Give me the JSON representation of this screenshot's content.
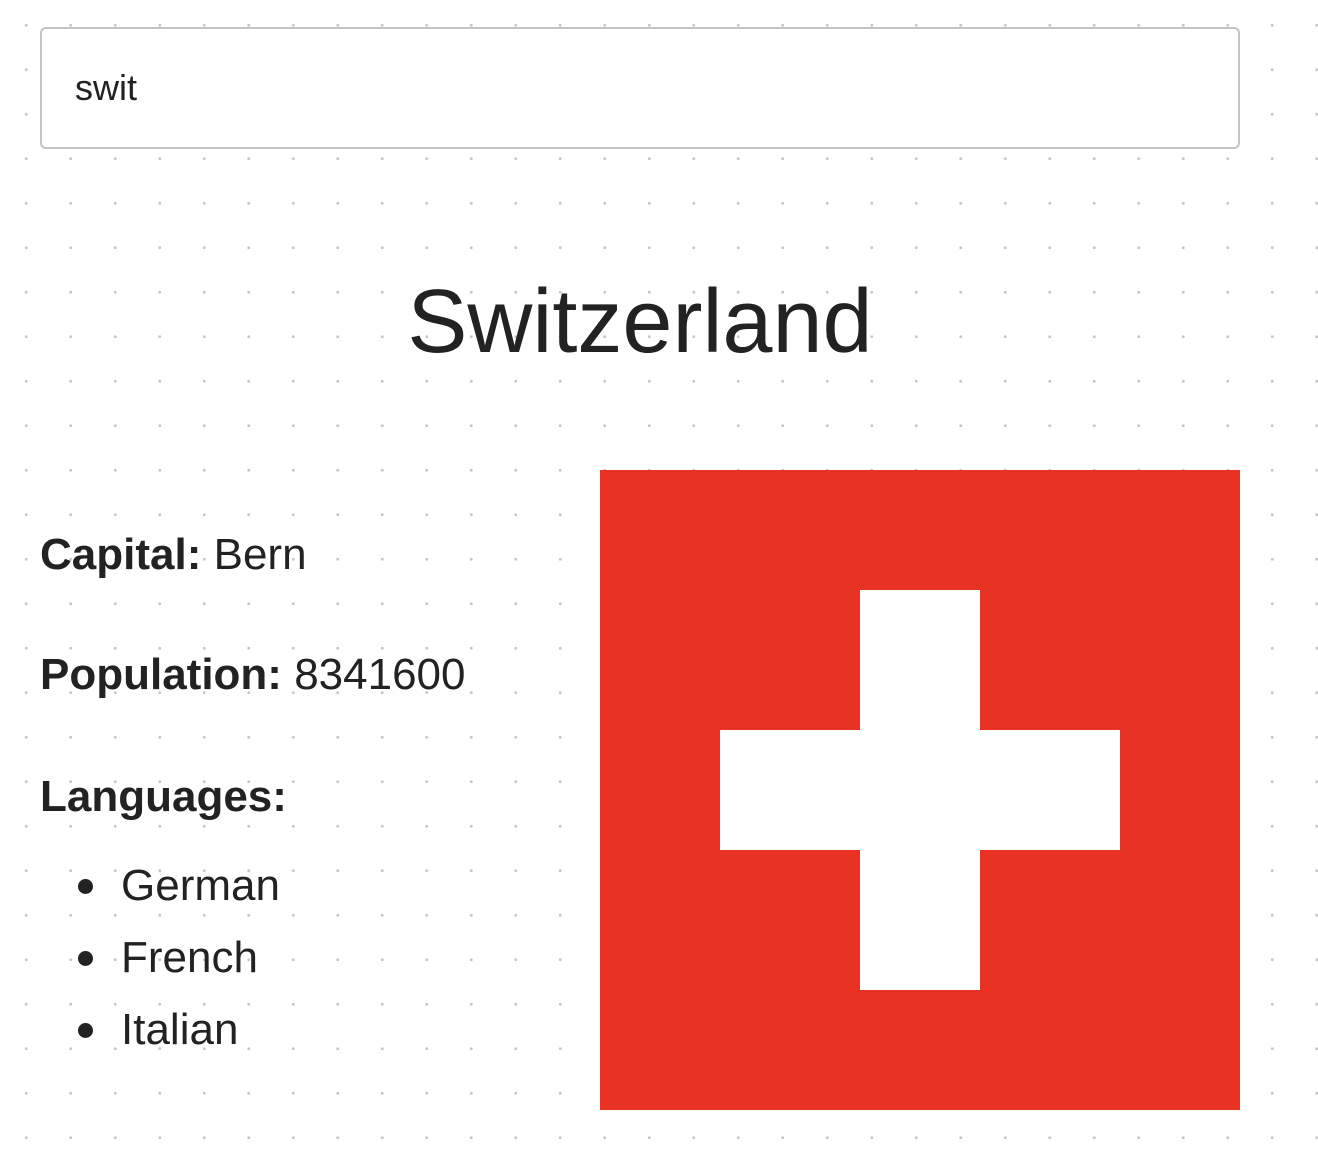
{
  "search": {
    "value": "swit",
    "placeholder": ""
  },
  "country": {
    "name": "Switzerland",
    "capital_label": "Capital:",
    "capital": "Bern",
    "population_label": "Population:",
    "population": "8341600",
    "languages_label": "Languages:",
    "languages": [
      "German",
      "French",
      "Italian"
    ]
  },
  "flag": {
    "icon": "swiss-flag",
    "colors": {
      "background": "#e83223",
      "cross": "#ffffff"
    }
  }
}
